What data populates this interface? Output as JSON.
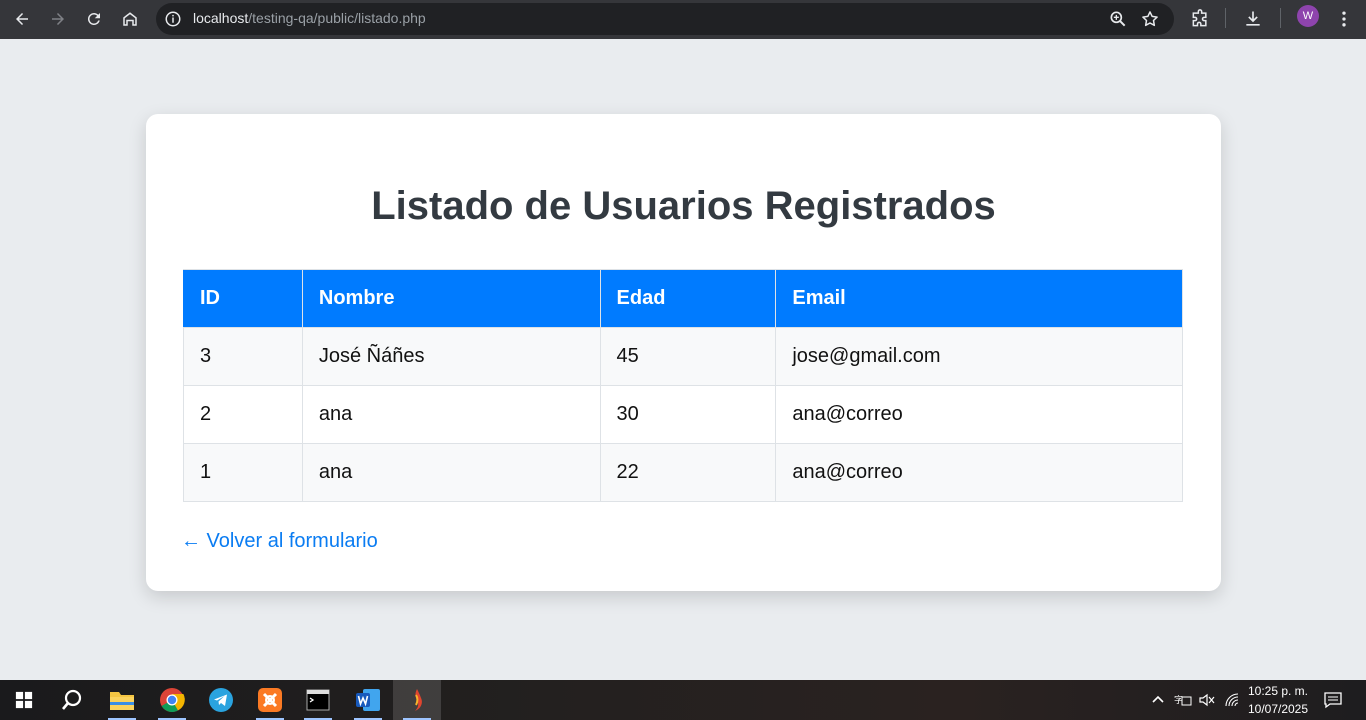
{
  "browser": {
    "url_host": "localhost",
    "url_path": "/testing-qa/public/listado.php",
    "profile_initial": "W"
  },
  "page": {
    "title": "Listado de Usuarios Registrados",
    "columns": [
      "ID",
      "Nombre",
      "Edad",
      "Email"
    ],
    "rows": [
      {
        "id": "3",
        "nombre": "José Ñáñes",
        "edad": "45",
        "email": "jose@gmail.com"
      },
      {
        "id": "2",
        "nombre": "ana",
        "edad": "30",
        "email": "ana@correo"
      },
      {
        "id": "1",
        "nombre": "ana",
        "edad": "22",
        "email": "ana@correo"
      }
    ],
    "back_link": "← Volver al formulario"
  },
  "colors": {
    "header_blue": "#007bff",
    "link_blue": "#0a7cf2",
    "page_bg": "#e9ecef"
  },
  "taskbar": {
    "clock_time": "10:25 p. m.",
    "clock_date": "10/07/2025"
  }
}
